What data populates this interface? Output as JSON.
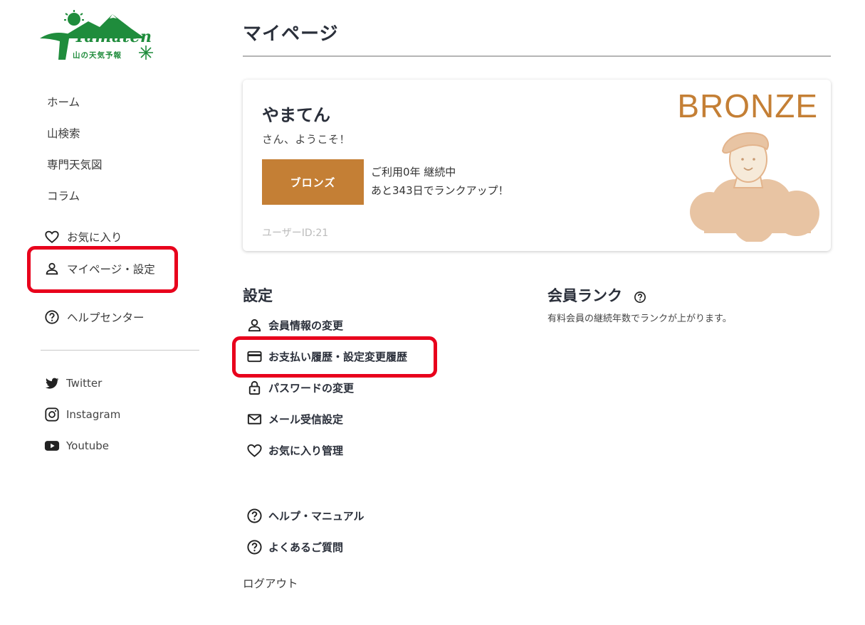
{
  "logo": {
    "wordmark": "Yamaten",
    "subtitle": "山の天気予報"
  },
  "sidebar": {
    "items": [
      {
        "label": "ホーム"
      },
      {
        "label": "山検索"
      },
      {
        "label": "専門天気図"
      },
      {
        "label": "コラム"
      }
    ],
    "favorites_label": "お気に入り",
    "mypage_label": "マイページ・設定",
    "help_label": "ヘルプセンター",
    "social": [
      {
        "label": "Twitter",
        "icon": "twitter-icon"
      },
      {
        "label": "Instagram",
        "icon": "instagram-icon"
      },
      {
        "label": "Youtube",
        "icon": "youtube-icon"
      }
    ]
  },
  "page": {
    "title": "マイページ"
  },
  "profile": {
    "name": "やまてん",
    "welcome": "さん、ようこそ！",
    "rank_badge": "ブロンズ",
    "usage_line1": "ご利用0年 継続中",
    "usage_line2": "あと343日でランクアップ！",
    "user_id": "ユーザーID:21",
    "rank_label": "BRONZE"
  },
  "settings": {
    "title": "設定",
    "items": [
      {
        "label": "会員情報の変更",
        "icon": "person-icon"
      },
      {
        "label": "お支払い履歴・設定変更履歴",
        "icon": "credit-card-icon"
      },
      {
        "label": "パスワードの変更",
        "icon": "lock-icon"
      },
      {
        "label": "メール受信設定",
        "icon": "mail-icon"
      },
      {
        "label": "お気に入り管理",
        "icon": "heart-icon"
      }
    ],
    "help_items": [
      {
        "label": "ヘルプ・マニュアル",
        "icon": "help-circle-icon"
      },
      {
        "label": "よくあるご質問",
        "icon": "help-circle-icon"
      }
    ],
    "logout_label": "ログアウト"
  },
  "membership": {
    "title": "会員ランク",
    "description": "有料会員の継続年数でランクが上がります。"
  },
  "colors": {
    "accent": "#c47f35",
    "highlight": "#e8001c",
    "brand": "#1f8c3c"
  }
}
